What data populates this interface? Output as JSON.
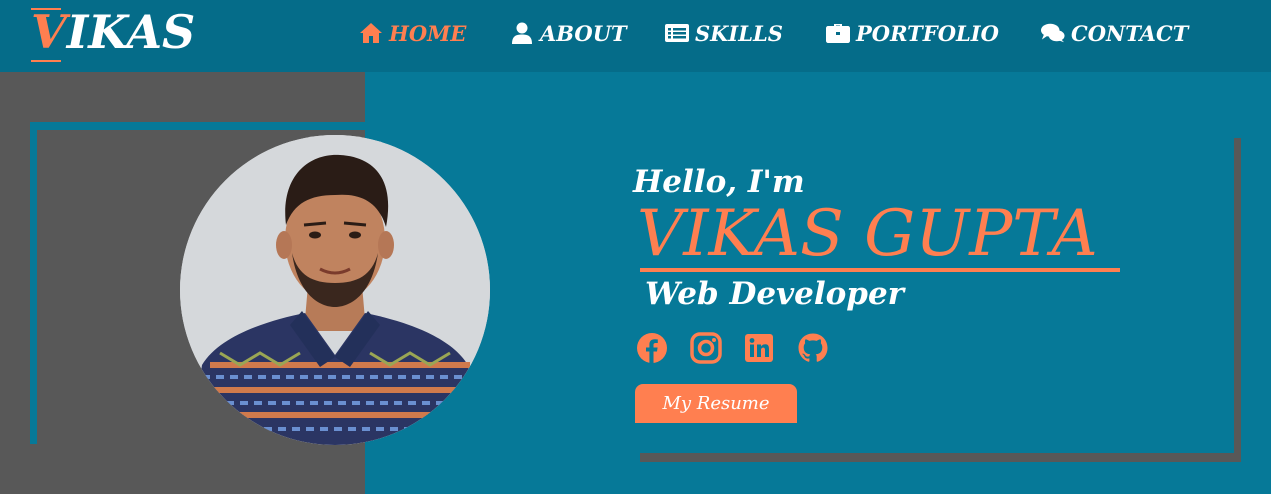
{
  "brand": {
    "first_letter": "V",
    "rest": "IKAS",
    "accent": "#ff7f50"
  },
  "nav": [
    {
      "label": "HOME",
      "icon": "home-icon",
      "active": true
    },
    {
      "label": "ABOUT",
      "icon": "user-icon",
      "active": false
    },
    {
      "label": "SKILLS",
      "icon": "list-icon",
      "active": false
    },
    {
      "label": "PORTFOLIO",
      "icon": "briefcase-icon",
      "active": false
    },
    {
      "label": "CONTACT",
      "icon": "comments-icon",
      "active": false
    }
  ],
  "hero": {
    "greeting": "Hello, I'm",
    "name": "VIKAS GUPTA",
    "role": "Web Developer",
    "social": [
      "facebook-icon",
      "instagram-icon",
      "linkedin-icon",
      "github-icon"
    ],
    "resume_button": "My Resume"
  },
  "colors": {
    "primary": "#067998",
    "nav": "#056c89",
    "accent": "#ff7f50",
    "gray": "#585858"
  }
}
